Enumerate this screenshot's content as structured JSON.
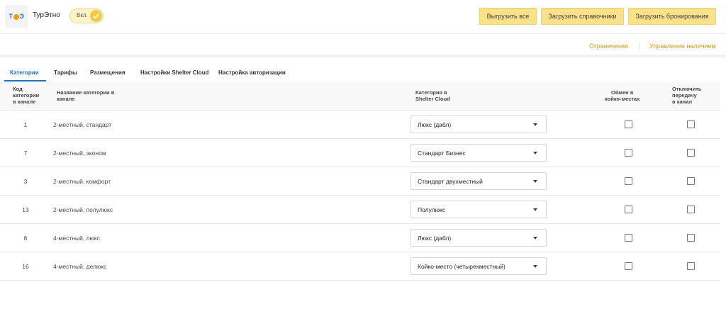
{
  "header": {
    "logo_text": "ТурЭтно",
    "app_title": "ТурЭтно",
    "toggle_label": "Вкл.",
    "buttons": {
      "export_all": "Выгрузить все",
      "load_directories": "Загрузить справочники",
      "load_bookings": "Загрузить бронирования"
    }
  },
  "subnav": {
    "restrictions": "Ограничения",
    "availability": "Управление наличием"
  },
  "tabs": [
    {
      "label": "Категории",
      "active": true
    },
    {
      "label": "Тарифы",
      "active": false
    },
    {
      "label": "Размещения",
      "active": false
    },
    {
      "label": "Настройки Shelter Cloud",
      "active": false
    },
    {
      "label": "Настройка авторизации",
      "active": false
    }
  ],
  "table": {
    "headers": {
      "code": "Код\nкатегории\nв канале",
      "name": "Название категории в\nканале",
      "shelter_category": "Категория в\nShelter Cloud",
      "exchange_beds": "Обмен в\nкойко-местах",
      "disable_transfer": "Отключить\nпередачу\nв канал"
    },
    "rows": [
      {
        "code": "1",
        "name": "2-местный, стандарт",
        "category": "Люкс (дабл)",
        "exchange": false,
        "disable": false
      },
      {
        "code": "7",
        "name": "2-местный, эконом",
        "category": "Стандарт Бизнес",
        "exchange": false,
        "disable": false
      },
      {
        "code": "3",
        "name": "2-местный, комфорт",
        "category": "Стандарт двухместный",
        "exchange": false,
        "disable": false
      },
      {
        "code": "13",
        "name": "2-местный, полулюкс",
        "category": "Полулюкс",
        "exchange": false,
        "disable": false
      },
      {
        "code": "6",
        "name": "4-местный, люкс",
        "category": "Люкс (дабл)",
        "exchange": false,
        "disable": false
      },
      {
        "code": "16",
        "name": "4-местный, делюкс",
        "category": "Койко-место (четырехместный)",
        "exchange": false,
        "disable": false
      }
    ]
  },
  "colors": {
    "accent_yellow": "#fbe18a",
    "tab_active": "#1e73be",
    "link_gold": "#c79b26"
  }
}
